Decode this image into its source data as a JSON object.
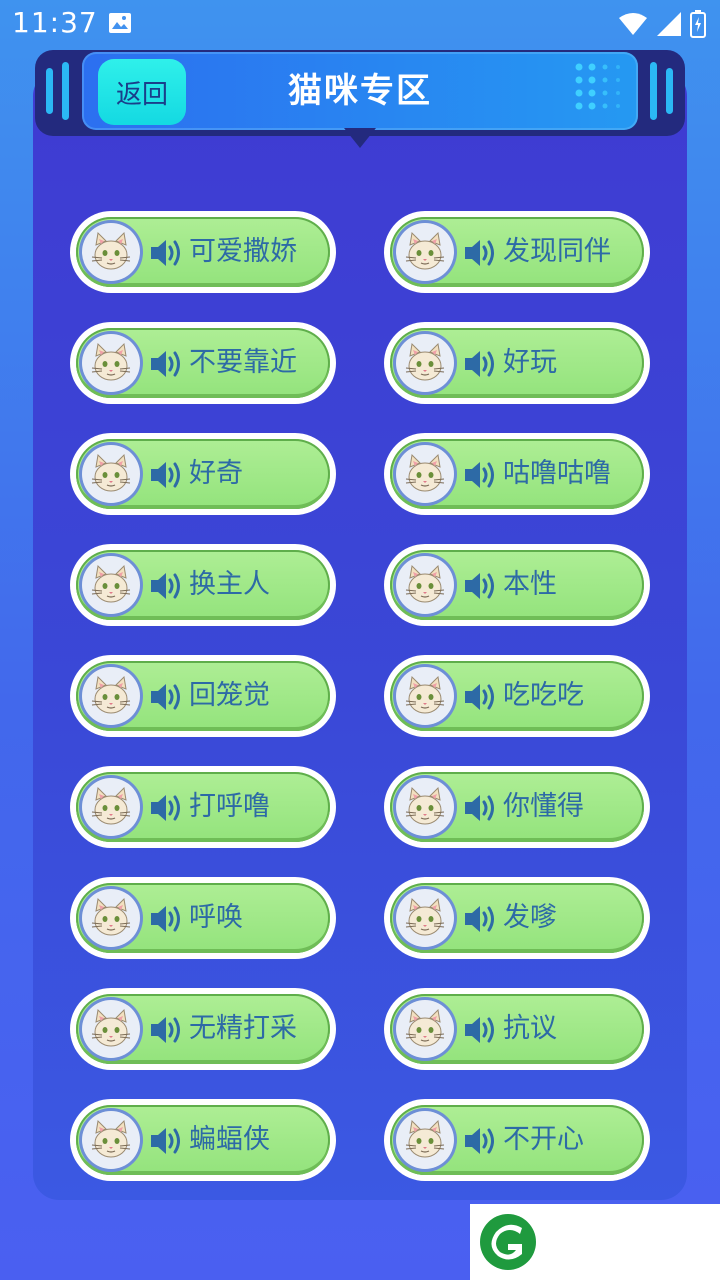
{
  "status_bar": {
    "time": "11:37"
  },
  "header": {
    "back_label": "返回",
    "title": "猫咪专区"
  },
  "sounds": [
    "可爱撒娇",
    "发现同伴",
    "不要靠近",
    "好玩",
    "好奇",
    "咕噜咕噜",
    "换主人",
    "本性",
    "回笼觉",
    "吃吃吃",
    "打呼噜",
    "你懂得",
    "呼唤",
    "发嗲",
    "无精打采",
    "抗议",
    "蝙蝠侠",
    "不开心"
  ],
  "colors": {
    "accent": "#2599f2",
    "button_green": "#9be881",
    "label": "#2d6aa6",
    "brand": "#1f9a3e"
  }
}
